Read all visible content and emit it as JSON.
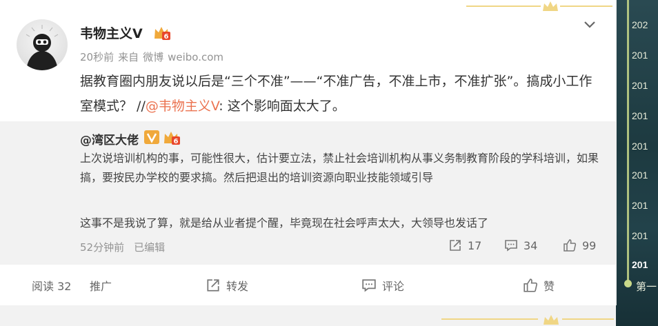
{
  "timeline": {
    "years": [
      "202",
      "201",
      "201",
      "201",
      "201",
      "201",
      "201",
      "201",
      "201"
    ],
    "active_year": "201",
    "first_label": "第一"
  },
  "post": {
    "author": "韦物主义V",
    "time": "20秒前",
    "source_prefix": "来自",
    "source_name": "微博",
    "source_domain": "weibo.com",
    "text_before": "据教育圈内朋友说以后是“三个不准”——“不准广告，不准上市，不准扩张”。搞成小工作室模式？ //",
    "mention": "@韦物主义V",
    "text_after": ": 这个影响面太大了。"
  },
  "repost": {
    "author": "@湾区大佬",
    "paragraph1": "上次说培训机构的事，可能性很大，估计要立法，禁止社会培训机构从事义务制教育阶段的学科培训，如果搞，要按民办学校的要求搞。然后把退出的培训资源向职业技能领域引导",
    "paragraph2": "这事不是我说了算，就是给从业者提个醒，毕竟现在社会呼声太大，大领导也发话了",
    "time": "52分钟前",
    "edited": "已编辑",
    "reposts": "17",
    "comments": "34",
    "likes": "99"
  },
  "actions": {
    "reads_label": "阅读 32",
    "promote_label": "推广",
    "repost_label": "转发",
    "comment_label": "评论",
    "like_label": "赞"
  },
  "colors": {
    "mention": "#eb7350",
    "gold": "#f0d685",
    "vip_orange": "#f0a93b",
    "badge_red": "#e8472b"
  }
}
